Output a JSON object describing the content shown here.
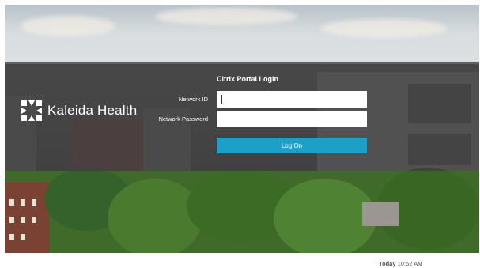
{
  "brand": {
    "name": "Kaleida Health",
    "logo_icon": "kaleida-logo-icon"
  },
  "login": {
    "title": "Citrix Portal Login",
    "network_id_label": "Network ID",
    "network_id_value": "",
    "network_password_label": "Network Password",
    "network_password_value": "",
    "logon_button": "Log On"
  },
  "status": {
    "day": "Today",
    "time": "10:52 AM"
  },
  "colors": {
    "button": "#1da0c8",
    "overlay": "#3e3e40"
  }
}
